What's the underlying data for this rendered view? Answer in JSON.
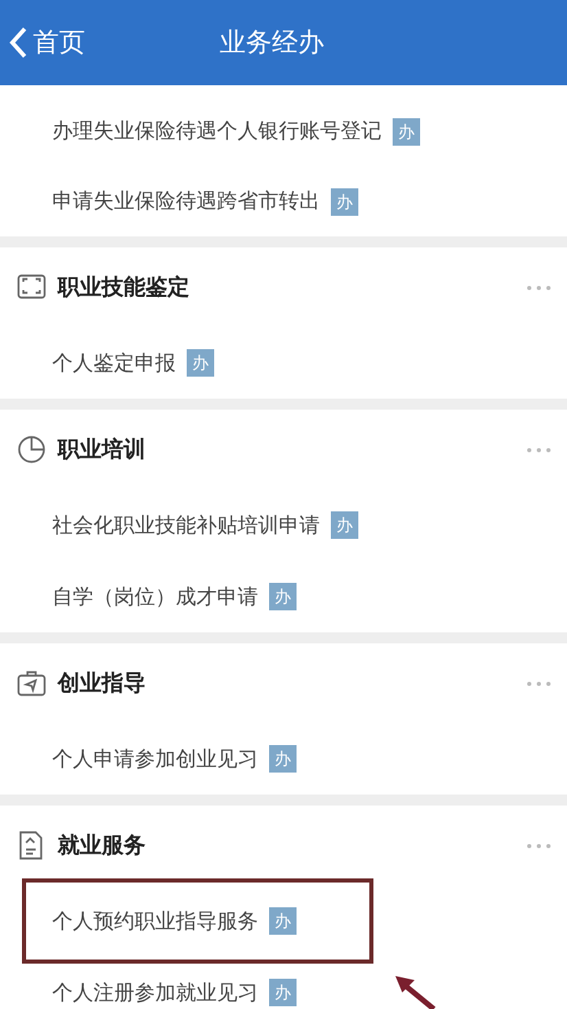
{
  "nav_bar": {
    "back_label": "首页",
    "title": "业务经办"
  },
  "sections": [
    {
      "items": [
        {
          "label": "办理失业保险待遇个人银行账号登记",
          "badge": "办",
          "highlighted": false
        },
        {
          "label": "申请失业保险待遇跨省市转出",
          "badge": "办",
          "highlighted": false
        }
      ]
    },
    {
      "title": "职业技能鉴定",
      "kind": "frame",
      "items": [
        {
          "label": "个人鉴定申报",
          "badge": "办",
          "highlighted": false
        }
      ]
    },
    {
      "title": "职业培训",
      "kind": "pie",
      "items": [
        {
          "label": "社会化职业技能补贴培训申请",
          "badge": "办",
          "highlighted": false
        },
        {
          "label": "自学（岗位）成才申请",
          "badge": "办",
          "highlighted": false
        }
      ]
    },
    {
      "title": "创业指导",
      "kind": "briefcase",
      "items": [
        {
          "label": "个人申请参加创业见习",
          "badge": "办",
          "highlighted": false
        }
      ]
    },
    {
      "title": "就业服务",
      "kind": "document",
      "items": [
        {
          "label": "个人预约职业指导服务",
          "badge": "办",
          "highlighted": true
        },
        {
          "label": "个人注册参加就业见习",
          "badge": "办",
          "highlighted": false
        }
      ]
    }
  ]
}
